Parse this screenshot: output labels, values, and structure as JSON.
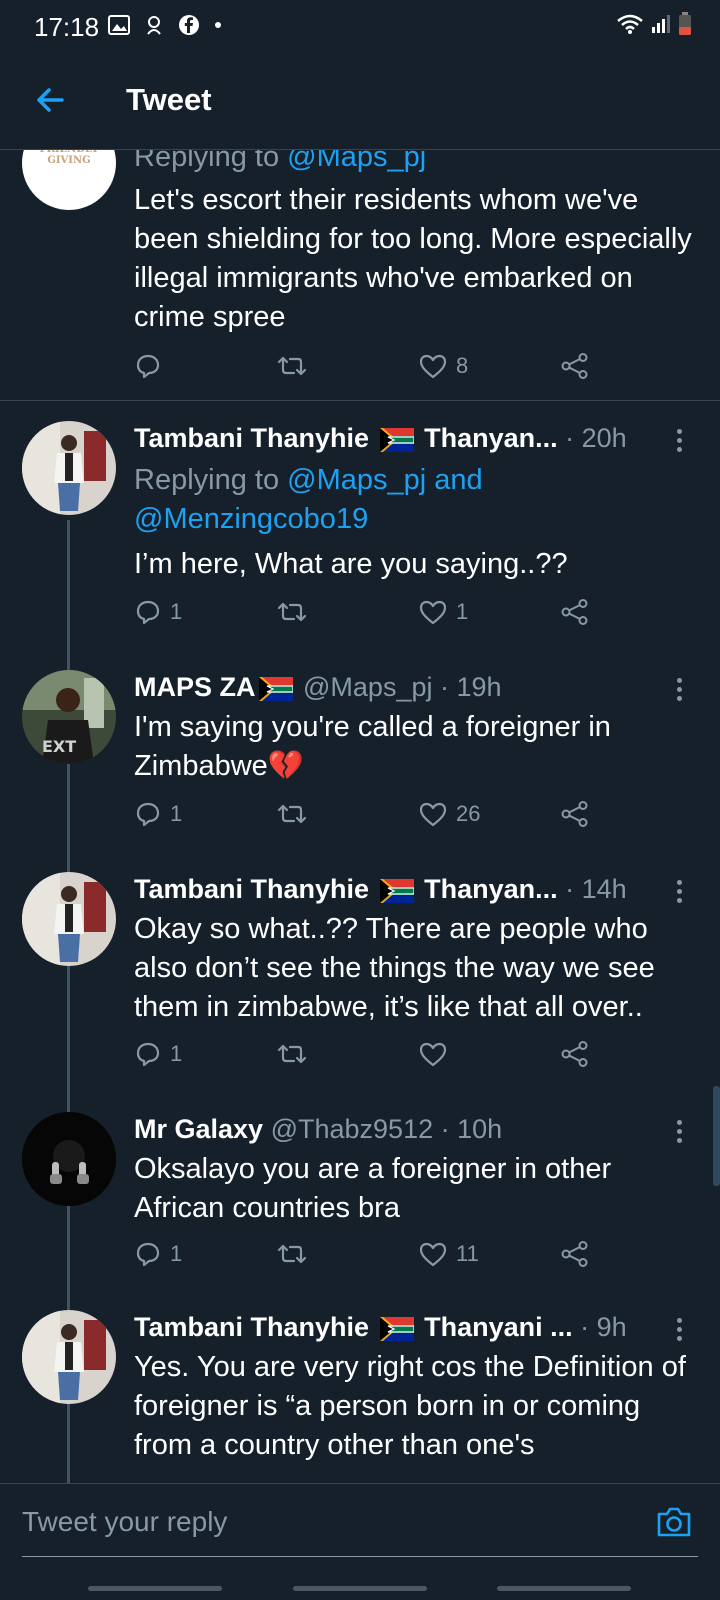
{
  "status": {
    "time": "17:18"
  },
  "header": {
    "title": "Tweet"
  },
  "first_tweet": {
    "replying_prefix": "Replying to ",
    "replying_to": "@Maps_pj",
    "text": "Let's escort their residents whom we've been shielding for too long. More especially illegal immigrants who've embarked on crime spree",
    "replies": "",
    "likes": "8",
    "avatar_text": "FRIENDLY GIVING"
  },
  "tweets": [
    {
      "name": "Tambani Thanyhie",
      "name_suffix": "Thanyan...",
      "handle": "",
      "time": "· 20h",
      "replying_prefix": "Replying to ",
      "replying_to": "@Maps_pj and @Menzingcobo19",
      "text": "I’m here, What are you saying..??",
      "replies": "1",
      "likes": "1"
    },
    {
      "name": "MAPS ZA",
      "name_suffix": "",
      "handle": "@Maps_pj",
      "time": "· 19h",
      "text": "I'm saying you're called a foreigner in Zimbabwe",
      "emoji": "💔",
      "replies": "1",
      "likes": "26"
    },
    {
      "name": "Tambani Thanyhie",
      "name_suffix": "Thanyan...",
      "handle": "",
      "time": "· 14h",
      "text": "Okay so what..?? There are people who also don’t see the things the way we see them in zimbabwe, it’s like that all over..",
      "replies": "1",
      "likes": ""
    },
    {
      "name": "Mr Galaxy",
      "name_suffix": "",
      "handle": "@Thabz9512",
      "time": "· 10h",
      "text": "Oksalayo you are a foreigner in other African countries bra",
      "replies": "1",
      "likes": "11"
    },
    {
      "name": "Tambani Thanyhie",
      "name_suffix": "Thanyani ...",
      "handle": "",
      "time": "· 9h",
      "text": "Yes. You are very right cos the Definition of foreigner is “a person born in or coming from a country other than one's",
      "replies": "",
      "likes": ""
    }
  ],
  "composer": {
    "placeholder": "Tweet your reply"
  },
  "colors": {
    "background": "#15202b",
    "accent": "#1da1f2",
    "muted": "#8899a6",
    "divider": "#38444d"
  },
  "icons": [
    "back-arrow-icon",
    "reply-icon",
    "retweet-icon",
    "like-icon",
    "share-icon",
    "more-icon",
    "camera-icon",
    "south-africa-flag-icon"
  ]
}
